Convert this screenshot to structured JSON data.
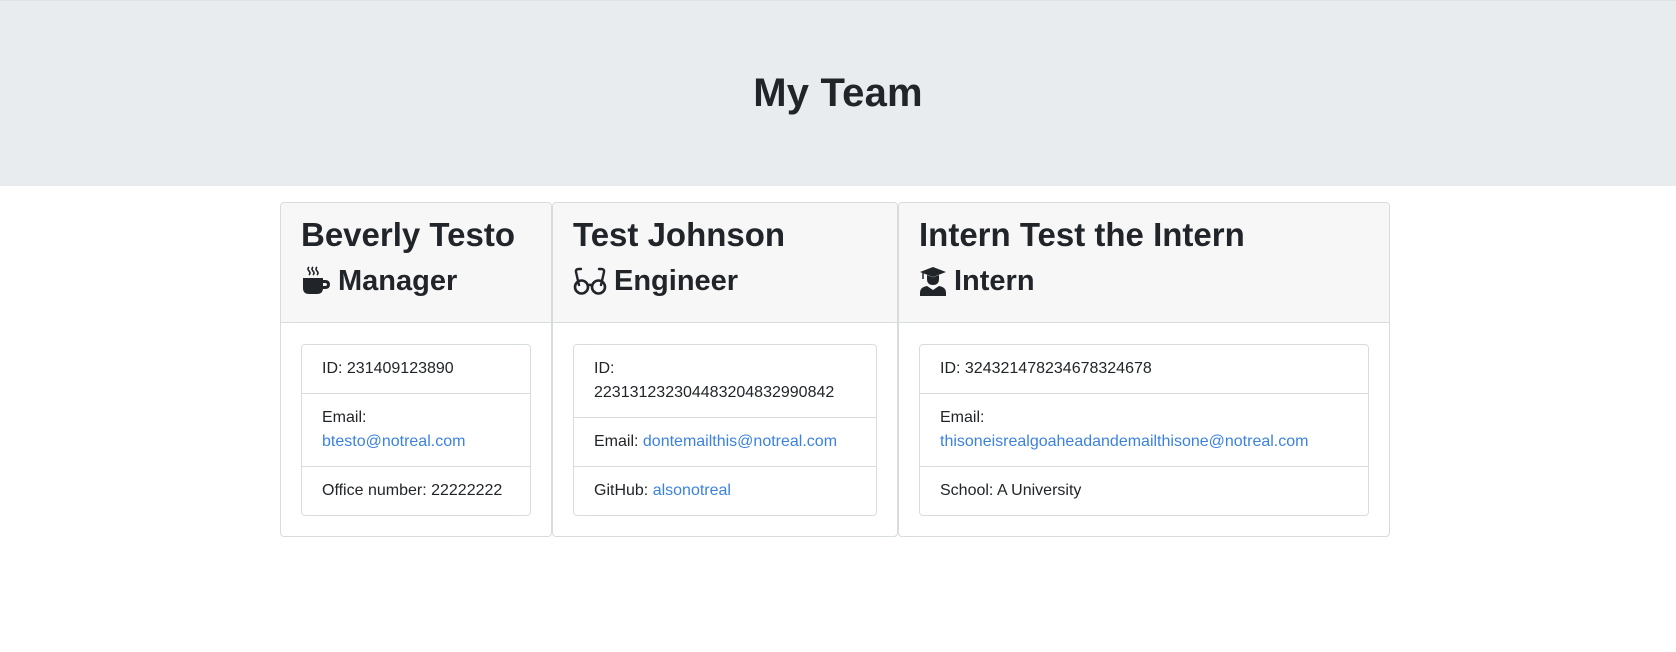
{
  "header": {
    "title": "My Team"
  },
  "members": [
    {
      "name": "Beverly Testo",
      "role": "Manager",
      "role_icon": "coffee-mug-icon",
      "id_label": "ID:",
      "id_value": "231409123890",
      "email_label": "Email:",
      "email": "btesto@notreal.com",
      "extra_label": "Office number:",
      "extra_value": "22222222"
    },
    {
      "name": "Test Johnson",
      "role": "Engineer",
      "role_icon": "glasses-icon",
      "id_label": "ID:",
      "id_value": "223131232304483204832990842",
      "email_label": "Email:",
      "email": "dontemailthis@notreal.com",
      "extra_label": "GitHub:",
      "extra_value": "alsonotreal"
    },
    {
      "name": "Intern Test the Intern",
      "role": "Intern",
      "role_icon": "graduate-icon",
      "id_label": "ID:",
      "id_value": "324321478234678324678",
      "email_label": "Email:",
      "email": "thisoneisrealgoaheadandemailthisone@notreal.com",
      "extra_label": "School:",
      "extra_value": "A University"
    }
  ],
  "colors": {
    "jumbotron_bg": "#e9ecef",
    "card_header_bg": "#f7f7f7",
    "link": "#3b82e0",
    "text": "#212529"
  }
}
